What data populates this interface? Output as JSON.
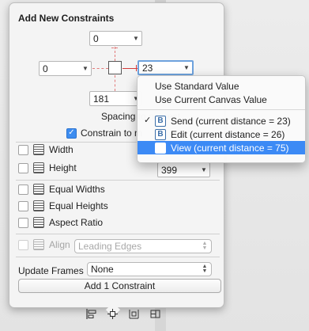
{
  "popover": {
    "title": "Add New Constraints",
    "top_value": "0",
    "left_value": "0",
    "right_value": "23",
    "bottom_value": "181",
    "spacing_label": "Spacing to nearest",
    "constrain_label": "Constrain to m",
    "width": {
      "label": "Width",
      "value": ""
    },
    "height": {
      "label": "Height",
      "value": "399"
    },
    "equal_widths": "Equal Widths",
    "equal_heights": "Equal Heights",
    "aspect_ratio": "Aspect Ratio",
    "align": {
      "label": "Align",
      "value": "Leading Edges"
    },
    "update_frames": {
      "label": "Update Frames",
      "value": "None"
    },
    "add_button": "Add 1 Constraint"
  },
  "menu": {
    "items": [
      {
        "label": "Use Standard Value"
      },
      {
        "label": "Use Current Canvas Value"
      },
      {
        "label": "Send (current distance = 23)",
        "icon": "B",
        "checked": true
      },
      {
        "label": "Edit (current distance = 26)",
        "icon": "B"
      },
      {
        "label": "View (current distance = 75)",
        "selected": true
      }
    ]
  },
  "toolbar": {
    "icons": [
      "align-icon",
      "pin-icon",
      "resolve-icon",
      "resizing-icon"
    ]
  },
  "colors": {
    "accent": "#3c8af5",
    "strut": "#d43a3a"
  }
}
